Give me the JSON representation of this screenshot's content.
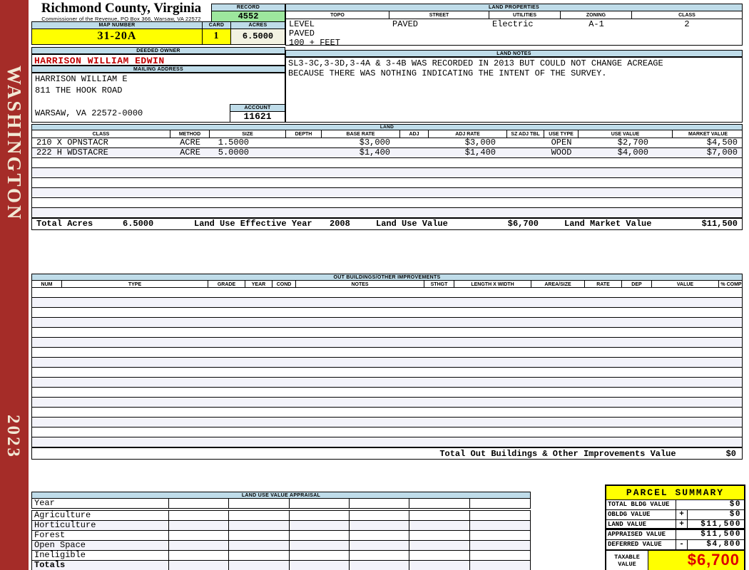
{
  "sidebar": {
    "district": "WASHINGTON",
    "year": "2023"
  },
  "colors": {
    "sidebar_red": "#A52C28",
    "header_blue": "#BFDCE9",
    "highlight_yellow": "#FFFF00",
    "record_green": "#9DE79D",
    "acres_cream": "#F2F2E2",
    "owner_red": "#C00000",
    "taxable_red": "#DD0000",
    "row_stripe": "#F3F3FA"
  },
  "header": {
    "county_title": "Richmond County, Virginia",
    "county_subtitle": "Commissioner of the Revenue, PO Box 366, Warsaw, VA 22572",
    "record_label": "RECORD",
    "record_value": "4552",
    "map_number_label": "MAP NUMBER",
    "map_number_value": "31-20A",
    "card_label": "CARD",
    "card_value": "1",
    "acres_label": "ACRES",
    "acres_value": "6.5000"
  },
  "land_properties": {
    "title": "LAND PROPERTIES",
    "columns": [
      "TOPO",
      "STREET",
      "UTILITIES",
      "ZONING",
      "CLASS"
    ],
    "topo_lines": [
      "LEVEL",
      "PAVED",
      "100 + FEET"
    ],
    "street": "PAVED",
    "utilities": "Electric",
    "zoning": "A-1",
    "class": "2"
  },
  "owner": {
    "deeded_owner_label": "DEEDED OWNER",
    "deeded_owner": "HARRISON WILLIAM EDWIN",
    "mailing_address_label": "MAILING ADDRESS",
    "address_lines": [
      "HARRISON WILLIAM E",
      "811 THE HOOK ROAD",
      "",
      "WARSAW, VA 22572-0000"
    ],
    "account_label": "ACCOUNT",
    "account_value": "11621"
  },
  "land_notes": {
    "title": "LAND NOTES",
    "lines": [
      "SL3-3C,3-3D,3-4A & 3-4B WAS RECORDED IN 2013 BUT COULD NOT CHANGE ACREAGE",
      "BECAUSE THERE WAS NOTHING INDICATING THE INTENT OF THE SURVEY."
    ]
  },
  "land": {
    "title": "LAND",
    "columns": [
      "CLASS",
      "METHOD",
      "SIZE",
      "DEPTH",
      "BASE RATE",
      "ADJ",
      "ADJ RATE",
      "SZ ADJ TBL",
      "USE TYPE",
      "USE VALUE",
      "MARKET VALUE"
    ],
    "rows": [
      [
        "210 X OPNSTACR",
        "ACRE",
        "1.5000",
        "",
        "$3,000",
        "",
        "$3,000",
        "",
        "OPEN",
        "$2,700",
        "$4,500"
      ],
      [
        "222 H WDSTACRE",
        "ACRE",
        "5.0000",
        "",
        "$1,400",
        "",
        "$1,400",
        "",
        "WOOD",
        "$4,000",
        "$7,000"
      ]
    ],
    "empty_row_count": 6,
    "totals": {
      "total_acres_label": "Total Acres",
      "total_acres": "6.5000",
      "effective_year_label": "Land Use Effective Year",
      "effective_year": "2008",
      "use_value_label": "Land Use Value",
      "use_value": "$6,700",
      "market_value_label": "Land Market Value",
      "market_value": "$11,500"
    }
  },
  "out_buildings": {
    "title": "OUT BUILDINGS/OTHER IMPROVEMENTS",
    "columns": [
      "NUM",
      "TYPE",
      "GRADE",
      "YEAR",
      "COND",
      "NOTES",
      "STHGT",
      "LENGTH X WIDTH",
      "AREA/SIZE",
      "RATE",
      "DEP",
      "VALUE",
      "% COMP"
    ],
    "empty_row_count": 16,
    "total_label": "Total Out Buildings & Other Improvements Value",
    "total_value": "$0"
  },
  "land_use_appraisal": {
    "title": "LAND USE VALUE APPRAISAL",
    "row_labels": [
      "Year",
      "Agriculture",
      "Horticulture",
      "Forest",
      "Open Space",
      "Ineligible",
      "Totals"
    ],
    "empty_col_count": 6
  },
  "parcel_summary": {
    "title": "PARCEL SUMMARY",
    "rows": [
      {
        "label": "TOTAL BLDG VALUE",
        "op": "",
        "value": "$0",
        "underline": false
      },
      {
        "label": "OBLDG VALUE",
        "op": "+",
        "value": "$0",
        "underline": false
      },
      {
        "label": "LAND VALUE",
        "op": "+",
        "value": "$11,500",
        "underline": true
      },
      {
        "label": "APPRAISED VALUE",
        "op": "",
        "value": "$11,500",
        "underline": false
      },
      {
        "label": "DEFERRED VALUE",
        "op": "-",
        "value": "$4,800",
        "underline": false
      }
    ],
    "taxable_label_line1": "TAXABLE",
    "taxable_label_line2": "VALUE",
    "taxable_value": "$6,700"
  }
}
